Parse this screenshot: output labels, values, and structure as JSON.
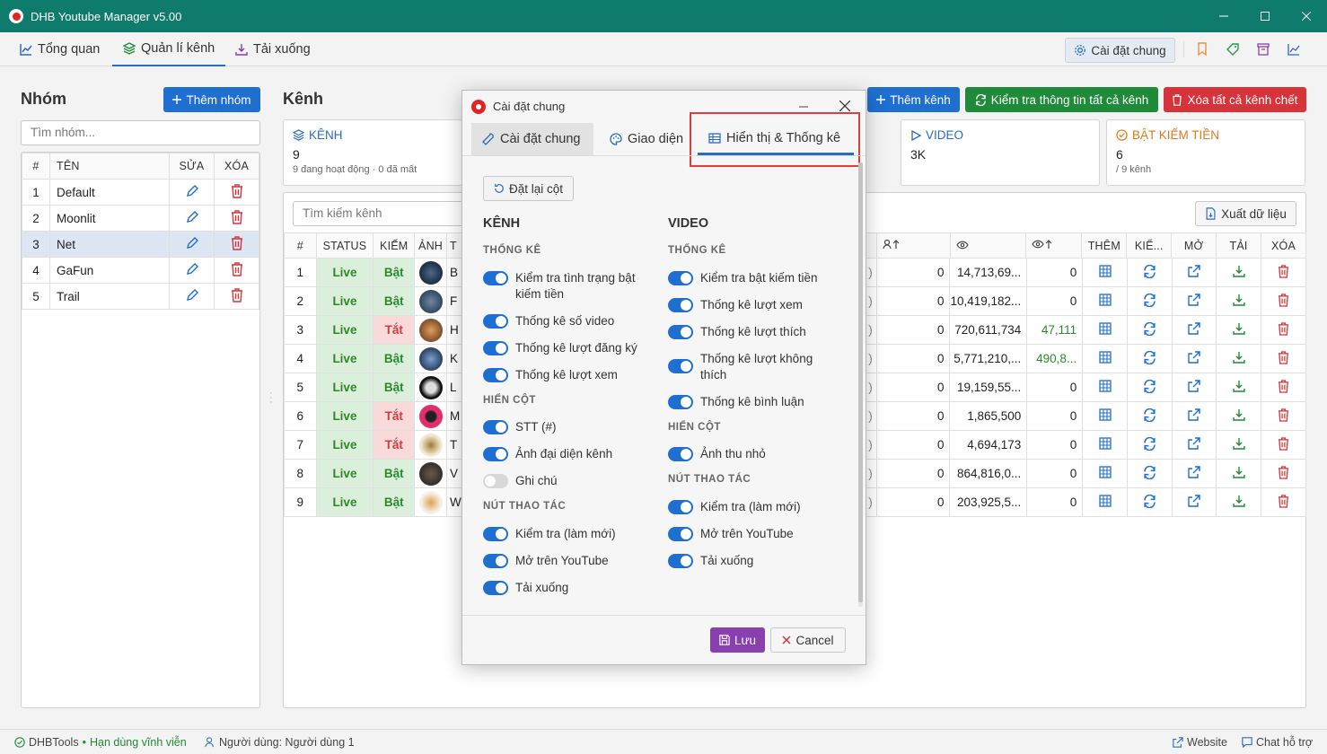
{
  "app": {
    "title": "DHB Youtube Manager v5.00"
  },
  "nav": {
    "tabs": [
      {
        "label": "Tổng quan"
      },
      {
        "label": "Quản lí kênh"
      },
      {
        "label": "Tải xuống"
      }
    ],
    "settings_button": "Cài đặt chung"
  },
  "groups": {
    "title": "Nhóm",
    "add_button": "Thêm nhóm",
    "search_placeholder": "Tìm nhóm...",
    "columns": {
      "num": "#",
      "name": "TÊN",
      "edit": "SỬA",
      "delete": "XÓA"
    },
    "rows": [
      {
        "num": "1",
        "name": "Default"
      },
      {
        "num": "2",
        "name": "Moonlit"
      },
      {
        "num": "3",
        "name": "Net"
      },
      {
        "num": "4",
        "name": "GaFun"
      },
      {
        "num": "5",
        "name": "Trail"
      }
    ]
  },
  "channels": {
    "title": "Kênh",
    "add_button": "Thêm kênh",
    "check_all_button": "Kiểm tra thông tin tất cả kênh",
    "delete_dead_button": "Xóa tất cả kênh chết",
    "search_placeholder": "Tìm kiếm kênh",
    "export_button": "Xuất dữ liệu",
    "stats": {
      "channels": {
        "label": "KÊNH",
        "value": "9",
        "sub": "9 đang hoạt động · 0 đã mất"
      },
      "video": {
        "label": "VIDEO",
        "value": "3K"
      },
      "monetize": {
        "label": "BẬT KIẾM TIỀN",
        "value": "6",
        "sub": "/ 9 kênh"
      }
    },
    "columns": {
      "num": "#",
      "status": "STATUS",
      "monetize": "KIẾM",
      "avatar": "ẢNH",
      "title": "T",
      "add": "THÊM",
      "check": "KIỂ...",
      "open": "MỞ",
      "download": "TẢI",
      "delete": "XÓA"
    },
    "rows": [
      {
        "num": "1",
        "status": "Live",
        "monetize": "Bật",
        "t": "B",
        "subs": "0",
        "views": "14,713,69...",
        "views_up": "0"
      },
      {
        "num": "2",
        "status": "Live",
        "monetize": "Bật",
        "t": "F",
        "subs": "0",
        "views": "10,419,182...",
        "views_up": "0"
      },
      {
        "num": "3",
        "status": "Live",
        "monetize": "Tắt",
        "t": "H",
        "subs": "0",
        "views": "720,611,734",
        "views_up": "47,111"
      },
      {
        "num": "4",
        "status": "Live",
        "monetize": "Bật",
        "t": "K",
        "subs": "0",
        "views": "5,771,210,...",
        "views_up": "490,8..."
      },
      {
        "num": "5",
        "status": "Live",
        "monetize": "Bật",
        "t": "L",
        "subs": "0",
        "views": "19,159,55...",
        "views_up": "0"
      },
      {
        "num": "6",
        "status": "Live",
        "monetize": "Tắt",
        "t": "M",
        "subs": "0",
        "views": "1,865,500",
        "views_up": "0"
      },
      {
        "num": "7",
        "status": "Live",
        "monetize": "Tắt",
        "t": "T",
        "subs": "0",
        "views": "4,694,173",
        "views_up": "0"
      },
      {
        "num": "8",
        "status": "Live",
        "monetize": "Bật",
        "t": "V",
        "subs": "0",
        "views": "864,816,0...",
        "views_up": "0"
      },
      {
        "num": "9",
        "status": "Live",
        "monetize": "Bật",
        "t": "W",
        "subs": "0",
        "views": "203,925,5...",
        "views_up": "0"
      }
    ]
  },
  "dialog": {
    "title": "Cài đặt chung",
    "tabs": [
      {
        "label": "Cài đặt chung"
      },
      {
        "label": "Giao diện"
      },
      {
        "label": "Hiển thị & Thống kê"
      }
    ],
    "reset_button": "Đặt lại cột",
    "left": {
      "title": "KÊNH",
      "stats_header": "THỐNG KÊ",
      "stats": [
        "Kiểm tra tình trạng bật kiếm tiền",
        "Thống kê số video",
        "Thống kê lượt đăng ký",
        "Thống kê lượt xem"
      ],
      "columns_header": "HIỂN CỘT",
      "columns": [
        "STT (#)",
        "Ảnh đại diện kênh",
        "Ghi chú"
      ],
      "actions_header": "NÚT THAO TÁC",
      "actions": [
        "Kiểm tra (làm mới)",
        "Mở trên YouTube",
        "Tải xuống"
      ]
    },
    "right": {
      "title": "VIDEO",
      "stats_header": "THỐNG KÊ",
      "stats": [
        "Kiểm tra bật kiếm tiền",
        "Thống kê lượt xem",
        "Thống kê lượt thích",
        "Thống kê lượt không thích",
        "Thống kê bình luận"
      ],
      "columns_header": "HIỂN CỘT",
      "columns": [
        "Ảnh thu nhỏ"
      ],
      "actions_header": "NÚT THAO TÁC",
      "actions": [
        "Kiểm tra (làm mới)",
        "Mở trên YouTube",
        "Tải xuống"
      ]
    },
    "save_button": "Lưu",
    "cancel_button": "Cancel"
  },
  "statusbar": {
    "brand": "DHBTools",
    "license": "Hạn dùng vĩnh viễn",
    "user": "Người dùng: Người dùng 1",
    "website": "Website",
    "support": "Chat hỗ trợ"
  },
  "colors": {
    "titlebar": "#0f7b6c",
    "primary": "#1f6fd1",
    "green": "#1f8a3a",
    "red": "#d6333b",
    "purple": "#8a3fb0",
    "highlight": "#e03c3c"
  }
}
